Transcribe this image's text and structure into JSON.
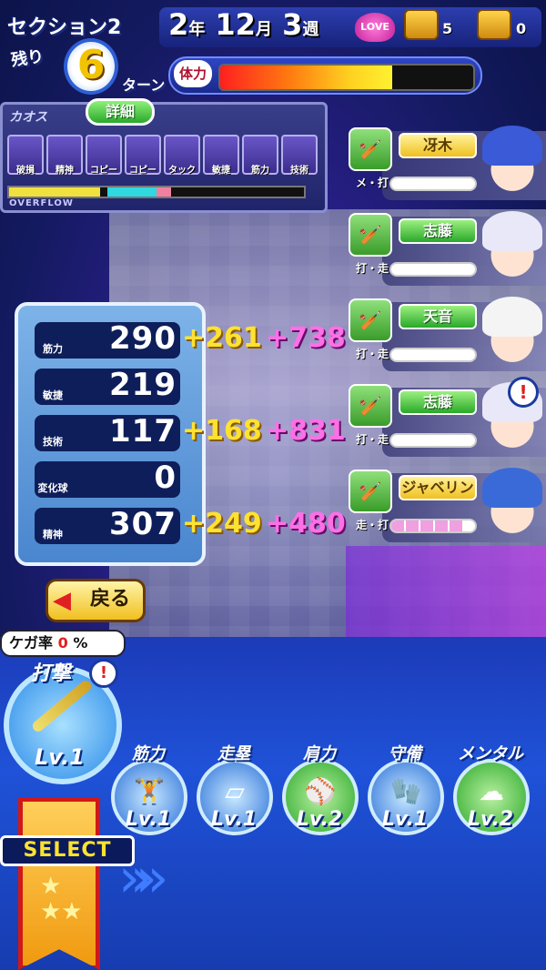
{
  "header": {
    "section": "セクション2",
    "remaining_label": "残り",
    "turns_left": "6",
    "turn_label": "ターン",
    "year": "2",
    "year_unit": "年",
    "month": "12",
    "month_unit": "月",
    "week": "3",
    "week_unit": "週",
    "love_label": "LOVE",
    "chest1_count": "5",
    "chest2_count": "0",
    "stamina_label": "体力",
    "stamina_fraction": 0.68
  },
  "chaos": {
    "label": "カオス",
    "detail_button": "詳細",
    "icons": [
      "破損",
      "精神",
      "コピー",
      "コピー",
      "タック",
      "敏捷",
      "筋力",
      "技術"
    ],
    "overflow_label": "OVERFLOW"
  },
  "stats": [
    {
      "icon": "dumbbell-icon",
      "label": "筋力",
      "value": "290",
      "bonus1": "+261",
      "bonus2": "+738"
    },
    {
      "icon": "shoe-icon",
      "label": "敏捷",
      "value": "219",
      "bonus1": "",
      "bonus2": ""
    },
    {
      "icon": "bat-icon",
      "label": "技術",
      "value": "117",
      "bonus1": "+168",
      "bonus2": "+831"
    },
    {
      "icon": "baseball-icon",
      "label": "変化球",
      "value": "0",
      "bonus1": "",
      "bonus2": ""
    },
    {
      "icon": "spirit-icon",
      "label": "精神",
      "value": "307",
      "bonus1": "+249",
      "bonus2": "+480"
    }
  ],
  "characters": [
    {
      "name": "冴木",
      "train": "メ・打",
      "style": "yellow",
      "gauge": 0.0,
      "hair": "#3a5ad8",
      "alert": false
    },
    {
      "name": "志藤",
      "train": "打・走",
      "style": "green",
      "gauge": 0.0,
      "hair": "#e8e8f8",
      "alert": false
    },
    {
      "name": "天音",
      "train": "打・走",
      "style": "green",
      "gauge": 0.0,
      "hair": "#f4f4f4",
      "alert": false
    },
    {
      "name": "志藤",
      "train": "打・走",
      "style": "green",
      "gauge": 0.0,
      "hair": "#e8e8f8",
      "alert": true
    },
    {
      "name": "ジャベリン",
      "train": "走・打",
      "style": "yellow",
      "gauge": 0.85,
      "hair": "#3a6ad8",
      "alert": false
    }
  ],
  "back_button": "戻る",
  "injury": {
    "label": "ケガ率",
    "value": "0",
    "unit": "%"
  },
  "selected_training": {
    "name": "打撃",
    "level": "Lv.1",
    "alert": "!"
  },
  "trainings": [
    {
      "name": "筋力",
      "level": "Lv.1",
      "glyph": "🏋"
    },
    {
      "name": "走塁",
      "level": "Lv.1",
      "glyph": "▱"
    },
    {
      "name": "肩力",
      "level": "Lv.2",
      "glyph": "⚾"
    },
    {
      "name": "守備",
      "level": "Lv.1",
      "glyph": "🧤"
    },
    {
      "name": "メンタル",
      "level": "Lv.2",
      "glyph": "☁"
    }
  ],
  "select_label": "SELECT"
}
